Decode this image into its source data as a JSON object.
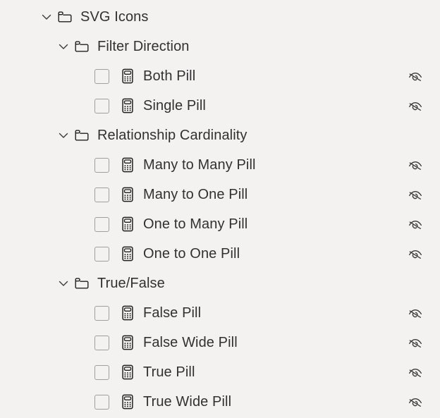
{
  "panel": {
    "name": "svg-icons-tree",
    "background_color": "#f3f2f1",
    "text_color": "#323130",
    "checkbox_border_color": "#a19f9d"
  },
  "icons": {
    "expanded_chevron": "chevron-down-icon",
    "folder": "folder-icon",
    "item": "calculator-icon",
    "visibility": "eye-off-icon",
    "checkbox": "checkbox-unchecked"
  },
  "tree": {
    "root": {
      "label": "SVG Icons",
      "expanded": true,
      "depth": 0
    },
    "groups": [
      {
        "label": "Filter Direction",
        "expanded": true,
        "depth": 1,
        "items": [
          {
            "label": "Both Pill",
            "checked": false,
            "visibility": "hidden"
          },
          {
            "label": "Single Pill",
            "checked": false,
            "visibility": "hidden"
          }
        ]
      },
      {
        "label": "Relationship Cardinality",
        "expanded": true,
        "depth": 1,
        "items": [
          {
            "label": "Many to Many Pill",
            "checked": false,
            "visibility": "hidden"
          },
          {
            "label": "Many to One Pill",
            "checked": false,
            "visibility": "hidden"
          },
          {
            "label": "One to Many Pill",
            "checked": false,
            "visibility": "hidden"
          },
          {
            "label": "One to One Pill",
            "checked": false,
            "visibility": "hidden"
          }
        ]
      },
      {
        "label": "True/False",
        "expanded": true,
        "depth": 1,
        "items": [
          {
            "label": "False Pill",
            "checked": false,
            "visibility": "hidden"
          },
          {
            "label": "False Wide Pill",
            "checked": false,
            "visibility": "hidden"
          },
          {
            "label": "True Pill",
            "checked": false,
            "visibility": "hidden"
          },
          {
            "label": "True Wide Pill",
            "checked": false,
            "visibility": "hidden"
          }
        ]
      }
    ]
  }
}
